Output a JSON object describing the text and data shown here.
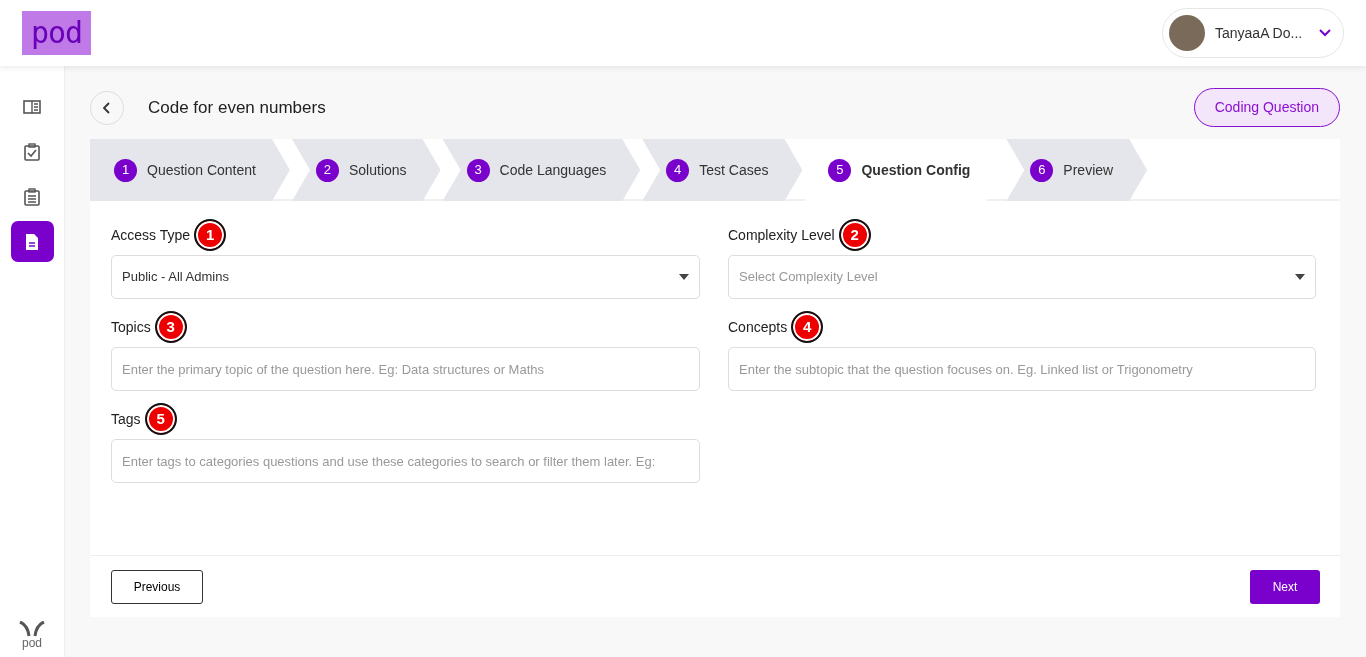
{
  "header": {
    "logo": "pod",
    "user": {
      "name": "TanyaaA Do..."
    }
  },
  "sidebar": {
    "items": [
      {
        "selected": false
      },
      {
        "selected": false
      },
      {
        "selected": false
      },
      {
        "selected": true
      }
    ],
    "footer_logo": "pod"
  },
  "page": {
    "title": "Code for even numbers",
    "type_badge": "Coding Question"
  },
  "steps": [
    {
      "number": "1",
      "label": "Question Content",
      "selected": false
    },
    {
      "number": "2",
      "label": "Solutions",
      "selected": false
    },
    {
      "number": "3",
      "label": "Code Languages",
      "selected": false
    },
    {
      "number": "4",
      "label": "Test Cases",
      "selected": false
    },
    {
      "number": "5",
      "label": "Question Config",
      "selected": true
    },
    {
      "number": "6",
      "label": "Preview",
      "selected": false
    }
  ],
  "fields": [
    {
      "label": "Access Type",
      "marker": "1",
      "kind": "select",
      "value": "Public - All Admins"
    },
    {
      "label": "Complexity Level",
      "marker": "2",
      "kind": "select",
      "placeholder": "Select Complexity Level"
    },
    {
      "label": "Topics",
      "marker": "3",
      "kind": "text",
      "placeholder": "Enter the primary topic of the question here. Eg: Data structures or Maths"
    },
    {
      "label": "Concepts",
      "marker": "4",
      "kind": "text",
      "placeholder": "Enter the subtopic that the question focuses on. Eg. Linked list or Trigonometry"
    },
    {
      "label": "Tags",
      "marker": "5",
      "kind": "text",
      "placeholder": "Enter tags to categories questions and use these categories to search or filter them later. Eg:"
    }
  ],
  "buttons": {
    "previous": "Previous",
    "next": "Next"
  }
}
